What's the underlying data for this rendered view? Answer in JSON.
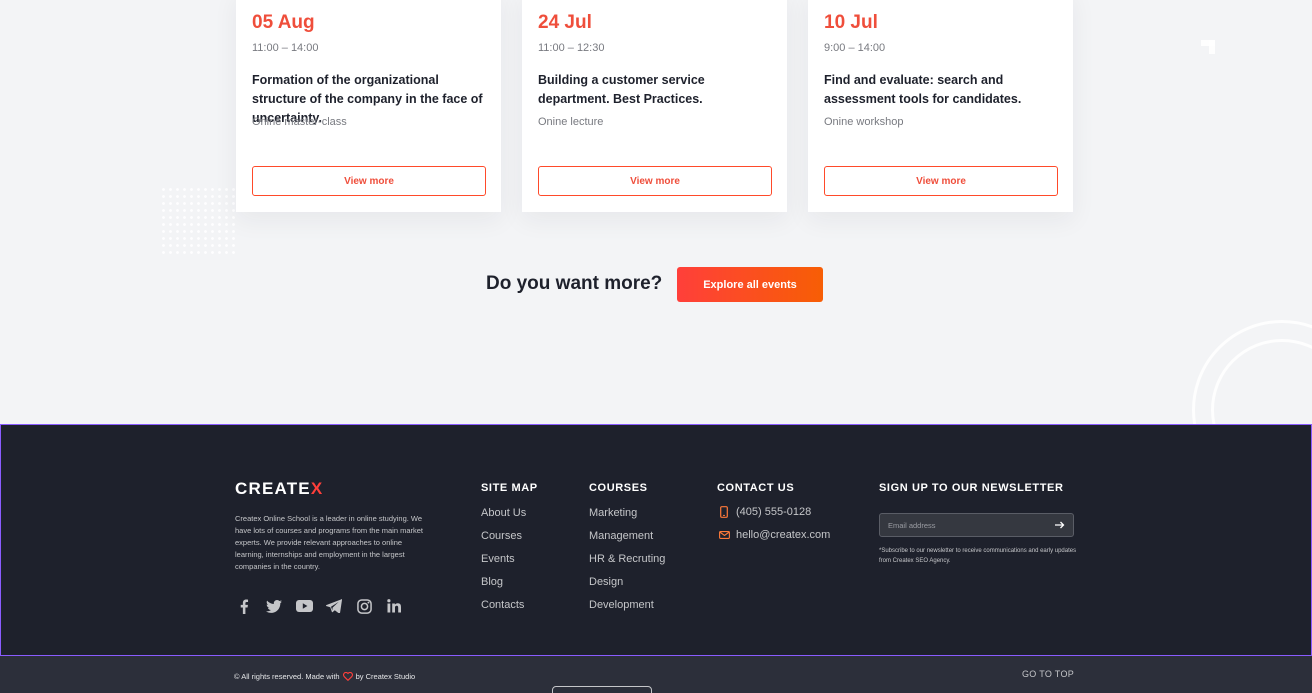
{
  "events": [
    {
      "date": "05 Aug",
      "time": "11:00 – 14:00",
      "title": "Formation of the organizational structure of the company in the face of uncertainty.",
      "type": "Onine master-class",
      "button": "View more"
    },
    {
      "date": "24 Jul",
      "time": "11:00 – 12:30",
      "title": "Building a customer service department. Best Practices.",
      "type": "Onine lecture",
      "button": "View more"
    },
    {
      "date": "10 Jul",
      "time": "9:00 – 14:00",
      "title": "Find and evaluate: search and assessment tools for candidates.",
      "type": "Onine workshop",
      "button": "View more"
    }
  ],
  "cta": {
    "heading": "Do you want more?",
    "button": "Explore all events"
  },
  "footer": {
    "logo_main": "CREATE",
    "logo_accent": "X",
    "about": "Createx Online School is a leader in online studying. We have lots of courses and programs from the main market experts. We provide relevant approaches to online learning, internships and employment in the largest companies in the country.",
    "socials": [
      "facebook-icon",
      "twitter-icon",
      "youtube-icon",
      "telegram-icon",
      "instagram-icon",
      "linkedin-icon"
    ],
    "sitemap": {
      "heading": "SITE MAP",
      "items": [
        "About Us",
        "Courses",
        "Events",
        "Blog",
        "Contacts"
      ]
    },
    "courses": {
      "heading": "COURSES",
      "items": [
        "Marketing",
        "Management",
        "HR & Recruting",
        "Design",
        "Development"
      ]
    },
    "contact": {
      "heading": "CONTACT US",
      "phone": "(405) 555-0128",
      "email": "hello@createx.com"
    },
    "newsletter": {
      "heading": "SIGN UP TO OUR NEWSLETTER",
      "placeholder": "Email address",
      "note": "*Subscribe to our newsletter to receive communications and early updates from Createx SEO Agency."
    },
    "copyright_before": "© All rights reserved. Made with",
    "copyright_after": "by Createx Studio",
    "go_to_top": "GO TO TOP"
  },
  "colors": {
    "accent": "#ef4e3b",
    "footer_bg": "#1e212c",
    "page_bg": "#f3f4f6"
  }
}
